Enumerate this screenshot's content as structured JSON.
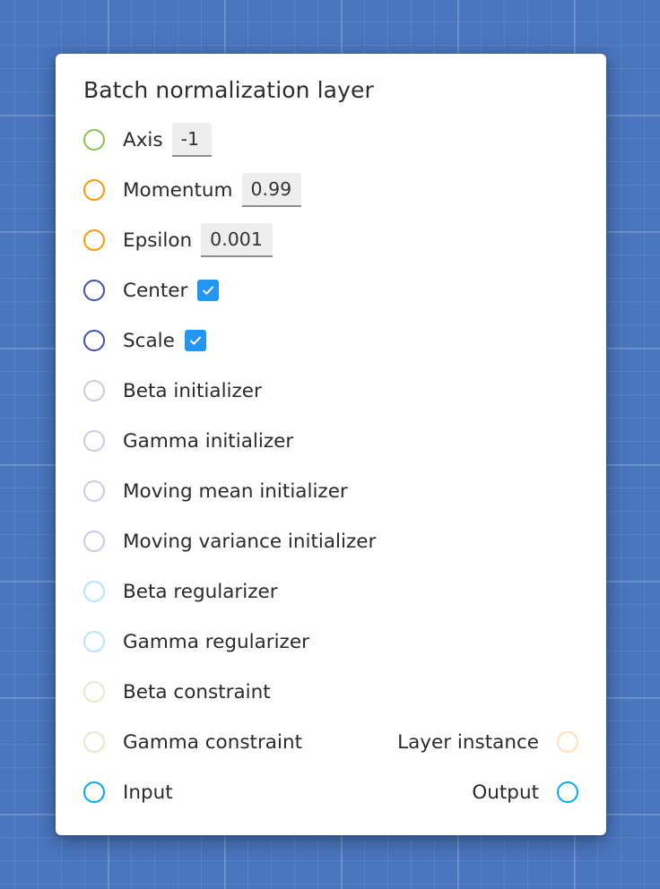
{
  "node": {
    "title": "Batch normalization layer",
    "params": {
      "axis": {
        "label": "Axis",
        "value": "-1",
        "socket_color": "#8bc34a"
      },
      "momentum": {
        "label": "Momentum",
        "value": "0.99",
        "socket_color": "#ff9800"
      },
      "epsilon": {
        "label": "Epsilon",
        "value": "0.001",
        "socket_color": "#ff9800"
      },
      "center": {
        "label": "Center",
        "checked": true,
        "socket_color": "#3f51b5"
      },
      "scale": {
        "label": "Scale",
        "checked": true,
        "socket_color": "#3f51b5"
      },
      "beta_initializer": {
        "label": "Beta initializer",
        "socket_color": "#c5cae9"
      },
      "gamma_initializer": {
        "label": "Gamma initializer",
        "socket_color": "#c5cae9"
      },
      "moving_mean_initializer": {
        "label": "Moving mean initializer",
        "socket_color": "#c5cae9"
      },
      "moving_variance_initializer": {
        "label": "Moving variance initializer",
        "socket_color": "#c5cae9"
      },
      "beta_regularizer": {
        "label": "Beta regularizer",
        "socket_color": "#b3e5fc"
      },
      "gamma_regularizer": {
        "label": "Gamma regularizer",
        "socket_color": "#b3e5fc"
      },
      "beta_constraint": {
        "label": "Beta constraint",
        "socket_color": "#dcedc8"
      },
      "gamma_constraint": {
        "label": "Gamma constraint",
        "socket_color": "#dcedc8"
      }
    },
    "layer_instance": {
      "label": "Layer instance",
      "socket_color": "#ffe0b2"
    },
    "input": {
      "label": "Input",
      "socket_color": "#03a9f4"
    },
    "output": {
      "label": "Output",
      "socket_color": "#03a9f4"
    },
    "checkbox_color": "#2196f3"
  }
}
